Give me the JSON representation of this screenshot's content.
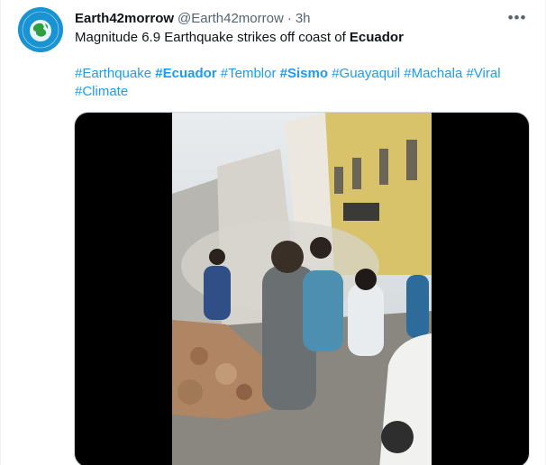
{
  "tweet": {
    "author_name": "Earth42morrow",
    "author_handle": "@Earth42morrow",
    "separator": "·",
    "time": "3h",
    "more_icon": "more-icon",
    "text_prefix": "Magnitude 6.9 Earthquake strikes off coast of ",
    "text_bold": "Ecuador",
    "hashtags": [
      {
        "text": "#Earthquake",
        "bold": false
      },
      {
        "text": "#Ecuador",
        "bold": true
      },
      {
        "text": "#Temblor",
        "bold": false
      },
      {
        "text": "#Sismo",
        "bold": true
      },
      {
        "text": "#Guayaquil",
        "bold": false
      },
      {
        "text": "#Machala",
        "bold": false
      },
      {
        "text": "#Viral",
        "bold": false
      },
      {
        "text": "#Climate",
        "bold": false
      }
    ]
  },
  "colors": {
    "link": "#1d9bf0",
    "secondary_text": "#536471",
    "avatar_bg": "#1a93d2"
  },
  "media": {
    "type": "video",
    "description_icon": "video-frame"
  }
}
